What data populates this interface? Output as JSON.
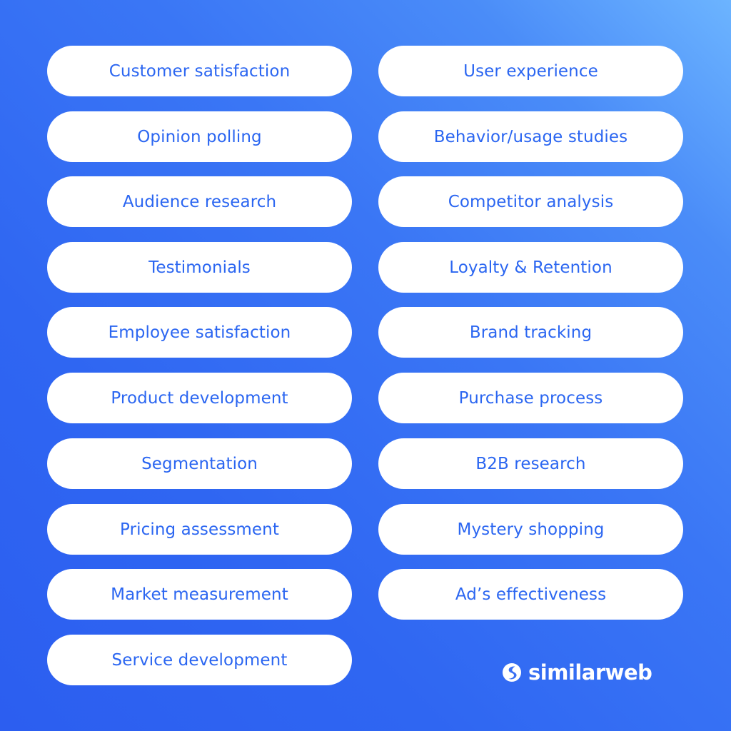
{
  "left_column": [
    "Customer satisfaction",
    "Opinion polling",
    "Audience research",
    "Testimonials",
    "Employee satisfaction",
    "Product development",
    "Segmentation",
    "Pricing assessment",
    "Market measurement",
    "Service development"
  ],
  "right_column": [
    "User experience",
    "Behavior/usage studies",
    "Competitor analysis",
    "Loyalty & Retention",
    "Brand tracking",
    "Purchase process",
    "B2B research",
    "Mystery shopping",
    "Ad’s effectiveness"
  ],
  "brand": {
    "name": "similarweb",
    "icon": "similarweb-logo-icon"
  },
  "colors": {
    "pill_text": "#2b66f1",
    "pill_bg": "#ffffff",
    "bg_dark": "#2c5ef0",
    "bg_light": "#6cb4ff"
  }
}
